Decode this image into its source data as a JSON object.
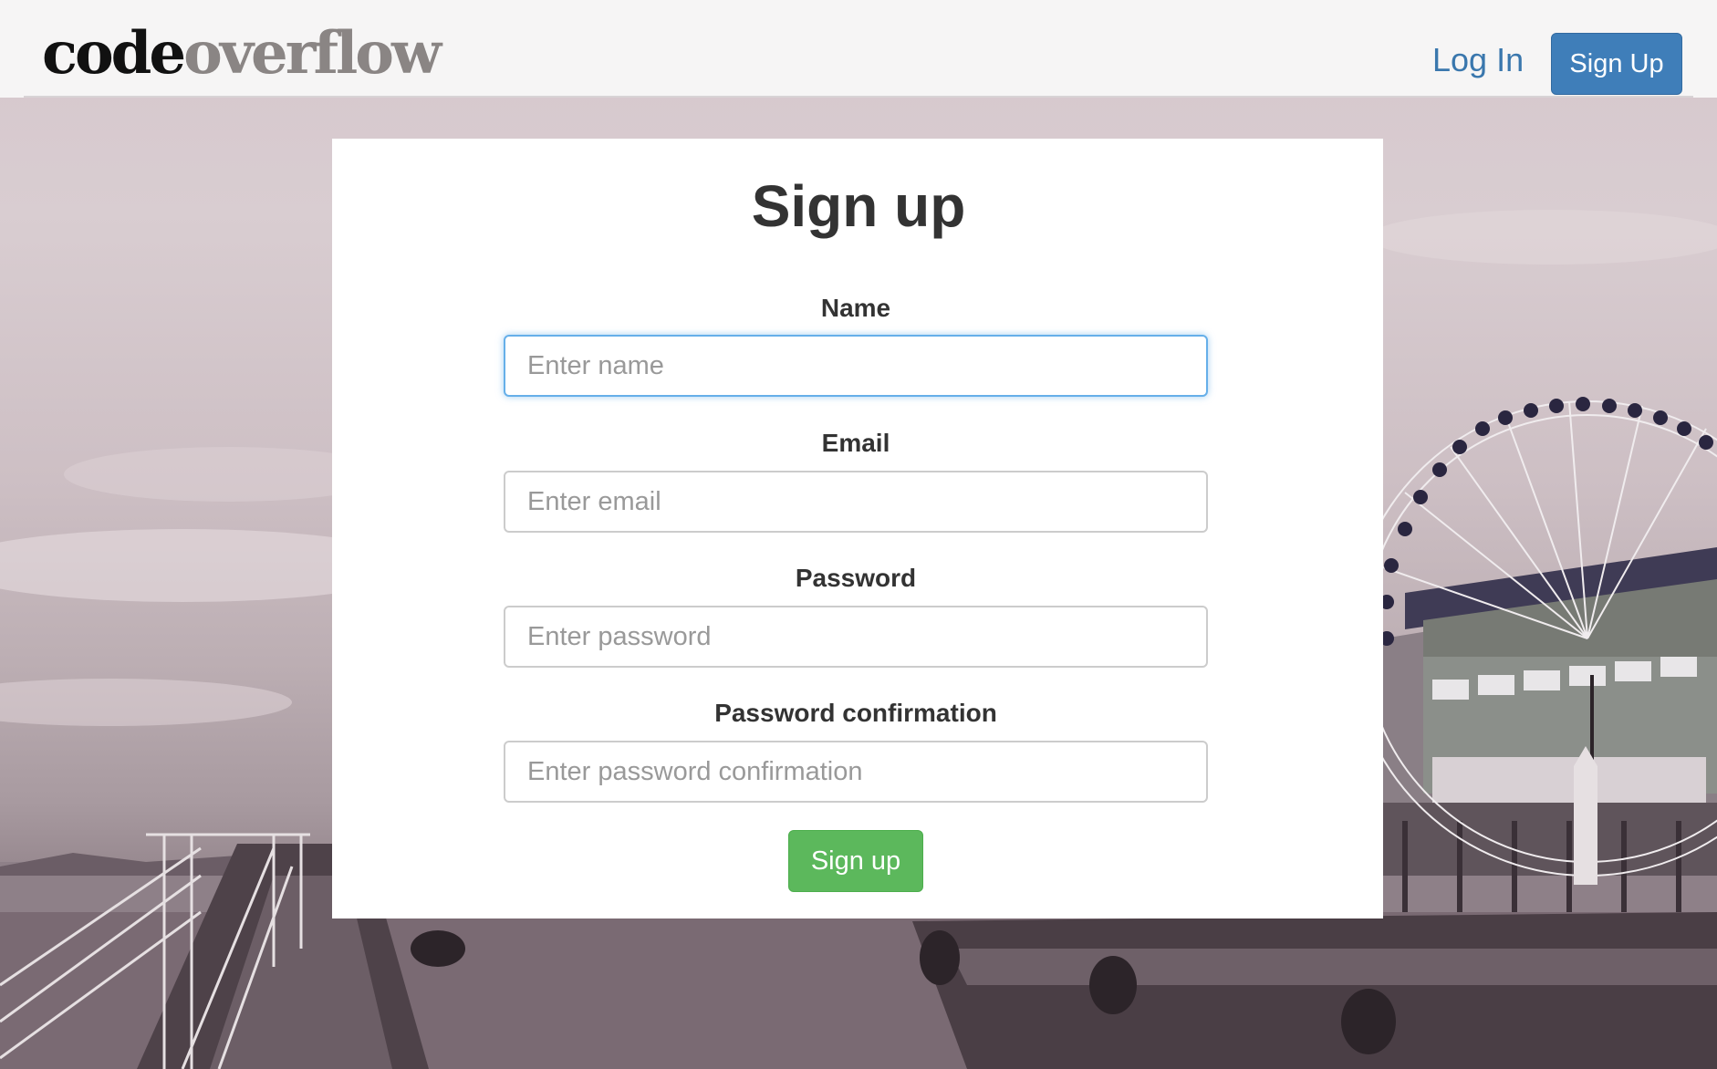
{
  "header": {
    "logo": {
      "part1": "code",
      "part2": "overflow"
    },
    "login_link": "Log In",
    "signup_button": "Sign Up"
  },
  "form": {
    "title": "Sign up",
    "fields": [
      {
        "label": "Name",
        "placeholder": "Enter name",
        "value": ""
      },
      {
        "label": "Email",
        "placeholder": "Enter email",
        "value": ""
      },
      {
        "label": "Password",
        "placeholder": "Enter password",
        "value": ""
      },
      {
        "label": "Password confirmation",
        "placeholder": "Enter password confirmation",
        "value": ""
      }
    ],
    "submit_label": "Sign up"
  },
  "colors": {
    "primary": "#3f7eb9",
    "link": "#3a77ad",
    "success": "#5cb85c",
    "focus": "#66afe9"
  }
}
